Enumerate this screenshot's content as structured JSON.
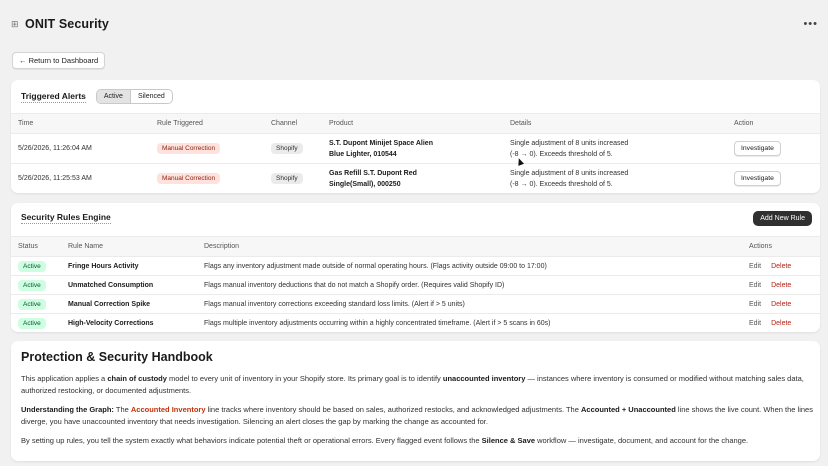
{
  "app": {
    "title": "ONIT Security"
  },
  "nav": {
    "back_label": "← Return to Dashboard"
  },
  "alerts": {
    "title": "Triggered Alerts",
    "tabs": [
      "Active",
      "Silenced"
    ],
    "columns": [
      "Time",
      "Rule Triggered",
      "Channel",
      "Product",
      "Details",
      "Action"
    ],
    "rows": [
      {
        "time": "5/26/2026, 11:26:04 AM",
        "rule": "Manual Correction",
        "channel": "Shopify",
        "product_line1": "S.T. Dupont Minijet Space Alien",
        "product_line2": "Blue Lighter, 010544",
        "details_line1": "Single adjustment of 8 units increased",
        "details_line2": "(-8 → 0). Exceeds threshold of 5.",
        "action": "Investigate"
      },
      {
        "time": "5/26/2026, 11:25:53 AM",
        "rule": "Manual Correction",
        "channel": "Shopify",
        "product_line1": "Gas Refill S.T. Dupont Red",
        "product_line2": "Single(Small), 000250",
        "details_line1": "Single adjustment of 8 units increased",
        "details_line2": "(-8 → 0). Exceeds threshold of 5.",
        "action": "Investigate"
      }
    ]
  },
  "rules": {
    "title": "Security Rules Engine",
    "add_label": "Add New Rule",
    "columns": [
      "Status",
      "Rule Name",
      "Description",
      "Actions"
    ],
    "rows": [
      {
        "status": "Active",
        "name": "Fringe Hours Activity",
        "description": "Flags any inventory adjustment made outside of normal operating hours. (Flags activity outside 09:00 to 17:00)",
        "edit": "Edit",
        "delete": "Delete"
      },
      {
        "status": "Active",
        "name": "Unmatched Consumption",
        "description": "Flags manual inventory deductions that do not match a Shopify order. (Requires valid Shopify ID)",
        "edit": "Edit",
        "delete": "Delete"
      },
      {
        "status": "Active",
        "name": "Manual Correction Spike",
        "description": "Flags manual inventory corrections exceeding standard loss limits. (Alert if > 5 units)",
        "edit": "Edit",
        "delete": "Delete"
      },
      {
        "status": "Active",
        "name": "High-Velocity Corrections",
        "description": "Flags multiple inventory adjustments occurring within a highly concentrated timeframe. (Alert if > 5 scans in 60s)",
        "edit": "Edit",
        "delete": "Delete"
      }
    ]
  },
  "handbook": {
    "title": "Protection & Security Handbook",
    "p1_a": "This application applies a ",
    "p1_b": "chain of custody",
    "p1_c": " model to every unit of inventory in your Shopify store. Its primary goal is to identify ",
    "p1_d": "unaccounted inventory",
    "p1_e": " — instances where inventory is consumed or modified without matching sales data, authorized restocking, or documented adjustments.",
    "p2_a": "Understanding the Graph:",
    "p2_b": " The ",
    "p2_c": "Accounted Inventory",
    "p2_d": " line tracks where inventory should be based on sales, authorized restocks, and acknowledged adjustments. The ",
    "p2_e": "Accounted + Unaccounted",
    "p2_f": " line shows the live count. When the lines diverge, you have unaccounted inventory that needs investigation. Silencing an alert closes the gap by marking the change as accounted for.",
    "p3_a": "By setting up rules, you tell the system exactly what behaviors indicate potential theft or operational errors. Every flagged event follows the ",
    "p3_b": "Silence & Save",
    "p3_c": " workflow — investigate, document, and account for the change."
  }
}
